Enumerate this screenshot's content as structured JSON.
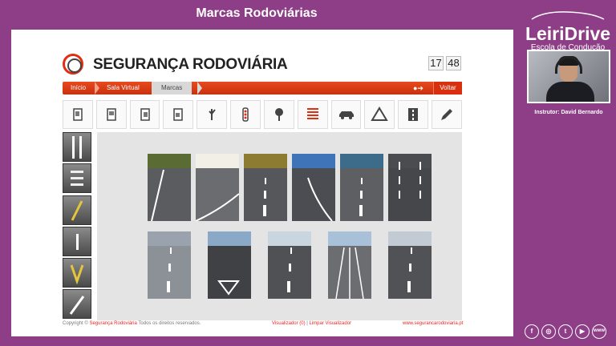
{
  "page": {
    "title": "Marcas Rodoviárias"
  },
  "site": {
    "brand": "SEGURANÇA RODOVIÁRIA",
    "date_day": "17",
    "date_month": "48",
    "breadcrumb": [
      "Início",
      "Sala Virtual",
      "Marcas"
    ],
    "back_label": "Voltar"
  },
  "toolbar": {
    "icons": [
      "sign-warning-icon",
      "sign-obligation-icon",
      "sign-prohibition-icon",
      "sign-info-icon",
      "traffic-officer-icon",
      "traffic-light-icon",
      "tree-icon",
      "road-markings-icon",
      "car-icon",
      "warning-triangle-icon",
      "road-icon",
      "pencil-icon"
    ]
  },
  "sidebar": {
    "items": [
      "longitudinal-markings",
      "transversal-markings",
      "edge-markings",
      "arrow-markings",
      "zebra-markings",
      "other-markings"
    ]
  },
  "gallery": {
    "photo_count": 12
  },
  "footer": {
    "copyright": "Copyright ©",
    "copyright_link": "Segurança Rodoviária",
    "rights": "Todos os direitos reservados.",
    "viewer": "Visualizador (0)",
    "separator": "|",
    "clear": "Limpar Visualizador",
    "url": "www.segurancarodoviaria.pt"
  },
  "school": {
    "name": "LeiriDrive",
    "subtitle": "Escola de Condução",
    "instructor": "Instrutor: David Bernardo"
  },
  "social": [
    "facebook-icon",
    "instagram-icon",
    "twitter-icon",
    "youtube-icon",
    "www-icon"
  ],
  "colors": {
    "background": "#8e3d87",
    "accent": "#e32d12"
  }
}
